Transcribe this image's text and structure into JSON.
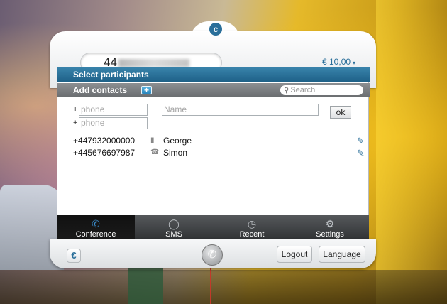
{
  "header": {
    "logo": "c",
    "number_value": "44",
    "balance": "€ 10,00",
    "balance_caret": "▾"
  },
  "panel": {
    "title": "Select participants",
    "add_contacts_label": "Add contacts",
    "add_button": "+",
    "search_placeholder": "Search"
  },
  "form": {
    "plus_sign": "+",
    "phone_placeholder": "phone",
    "name_placeholder": "Name",
    "ok_label": "ok"
  },
  "participants": [
    {
      "prefix": "+",
      "number": "447932000000",
      "device": "mobile-icon",
      "name": "George"
    },
    {
      "prefix": "+",
      "number": "445676697987",
      "device": "landline-icon",
      "name": "Simon"
    }
  ],
  "nav": {
    "items": [
      {
        "label": "Conference",
        "icon": "phone-icon",
        "active": true
      },
      {
        "label": "SMS",
        "icon": "speech-bubble-icon",
        "active": false
      },
      {
        "label": "Recent",
        "icon": "clock-icon",
        "active": false
      },
      {
        "label": "Settings",
        "icon": "gear-icon",
        "active": false
      }
    ]
  },
  "footer": {
    "euro_symbol": "€",
    "logout_label": "Logout",
    "language_label": "Language"
  },
  "colors": {
    "accent": "#2a6f9a",
    "header_bar": "#1d5f86",
    "secondary_bar": "#6a6d70"
  }
}
